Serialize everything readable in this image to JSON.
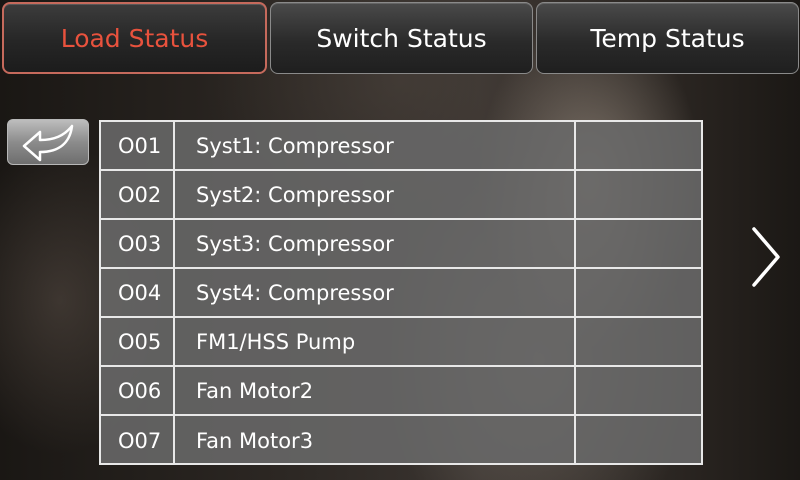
{
  "tabs": [
    {
      "label": "Load Status",
      "active": true
    },
    {
      "label": "Switch Status",
      "active": false
    },
    {
      "label": "Temp Status",
      "active": false
    }
  ],
  "colors": {
    "active_tab_text": "#e8523d",
    "tab_text": "#ffffff",
    "active_tab_border": "#c66a5c"
  },
  "navigation": {
    "back_icon": "back-arrow-icon",
    "next_icon": "chevron-right-icon"
  },
  "loads": [
    {
      "code": "O01",
      "name": "Syst1: Compressor",
      "status": ""
    },
    {
      "code": "O02",
      "name": "Syst2: Compressor",
      "status": ""
    },
    {
      "code": "O03",
      "name": "Syst3: Compressor",
      "status": ""
    },
    {
      "code": "O04",
      "name": "Syst4: Compressor",
      "status": ""
    },
    {
      "code": "O05",
      "name": "FM1/HSS Pump",
      "status": ""
    },
    {
      "code": "O06",
      "name": "Fan Motor2",
      "status": ""
    },
    {
      "code": "O07",
      "name": "Fan Motor3",
      "status": ""
    }
  ]
}
